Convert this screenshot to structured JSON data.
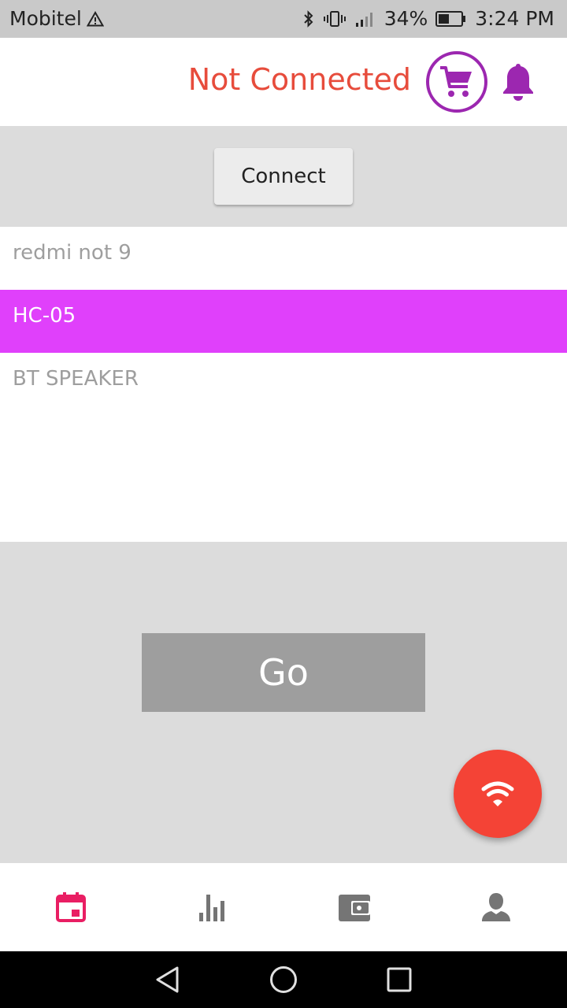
{
  "status_bar": {
    "carrier": "Mobitel",
    "battery": "34%",
    "time": "3:24 PM"
  },
  "header": {
    "connection_status": "Not Connected",
    "status_color": "#e74c3c",
    "accent_color": "#9c27b0"
  },
  "connect_button_label": "Connect",
  "devices": [
    {
      "name": "redmi not 9",
      "selected": false
    },
    {
      "name": "HC-05",
      "selected": true
    },
    {
      "name": "BT SPEAKER",
      "selected": false
    }
  ],
  "selected_color": "#e040fb",
  "go_button_label": "Go",
  "fab_icon": "wifi-icon",
  "bottom_nav": [
    {
      "icon": "calendar-icon",
      "active": true
    },
    {
      "icon": "bar-chart-icon",
      "active": false
    },
    {
      "icon": "wallet-icon",
      "active": false
    },
    {
      "icon": "person-icon",
      "active": false
    }
  ]
}
